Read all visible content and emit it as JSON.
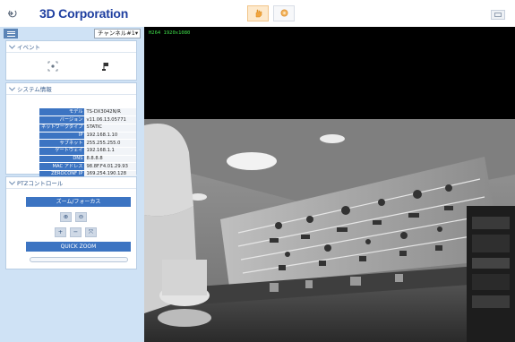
{
  "header": {
    "brand": "3D Corporation",
    "logout_icon": "logout-icon",
    "view_buttons": [
      {
        "icon": "hand-icon",
        "active": true
      },
      {
        "icon": "gear-icon",
        "active": false
      }
    ],
    "right_icon": "window-icon"
  },
  "sidebar": {
    "menu_icon": "hamburger-icon",
    "channel_select": "チャンネル#1▾",
    "event": {
      "title": "イベント",
      "icons": [
        "motion-detect-icon",
        "alarm-flag-icon"
      ]
    },
    "system": {
      "title": "システム情報",
      "rows": [
        {
          "key": "モデル",
          "value": "TS-DX3042N/R"
        },
        {
          "key": "バージョン",
          "value": "v11.06.13.05771"
        },
        {
          "key": "ネットワークタイプ",
          "value": "STATIC"
        },
        {
          "key": "IP",
          "value": "192.168.1.10"
        },
        {
          "key": "サブネット",
          "value": "255.255.255.0"
        },
        {
          "key": "ゲートウェイ",
          "value": "192.168.1.1"
        },
        {
          "key": "DNS",
          "value": "8.8.8.8"
        },
        {
          "key": "MAC アドレス",
          "value": "98.8F.F4.01.29.93"
        },
        {
          "key": "ZEROCONF IP",
          "value": "169.254.190.128"
        }
      ]
    },
    "ptz": {
      "title": "PTZコントロール",
      "zoom_focus_label": "ズーム/フォーカス",
      "zoom_buttons": [
        "⊕",
        "⊖"
      ],
      "focus_buttons": [
        "+",
        "−",
        "⤧"
      ],
      "quick_zoom_label": "QUICK ZOOM",
      "slider_value": 0.0
    }
  },
  "video": {
    "stream_label": "H264 1920x1080"
  },
  "colors": {
    "brand": "#1f3fa0",
    "sidebar_bg": "#cfe2f5",
    "accent": "#3c74c2",
    "stream_label": "#3fe04a"
  }
}
